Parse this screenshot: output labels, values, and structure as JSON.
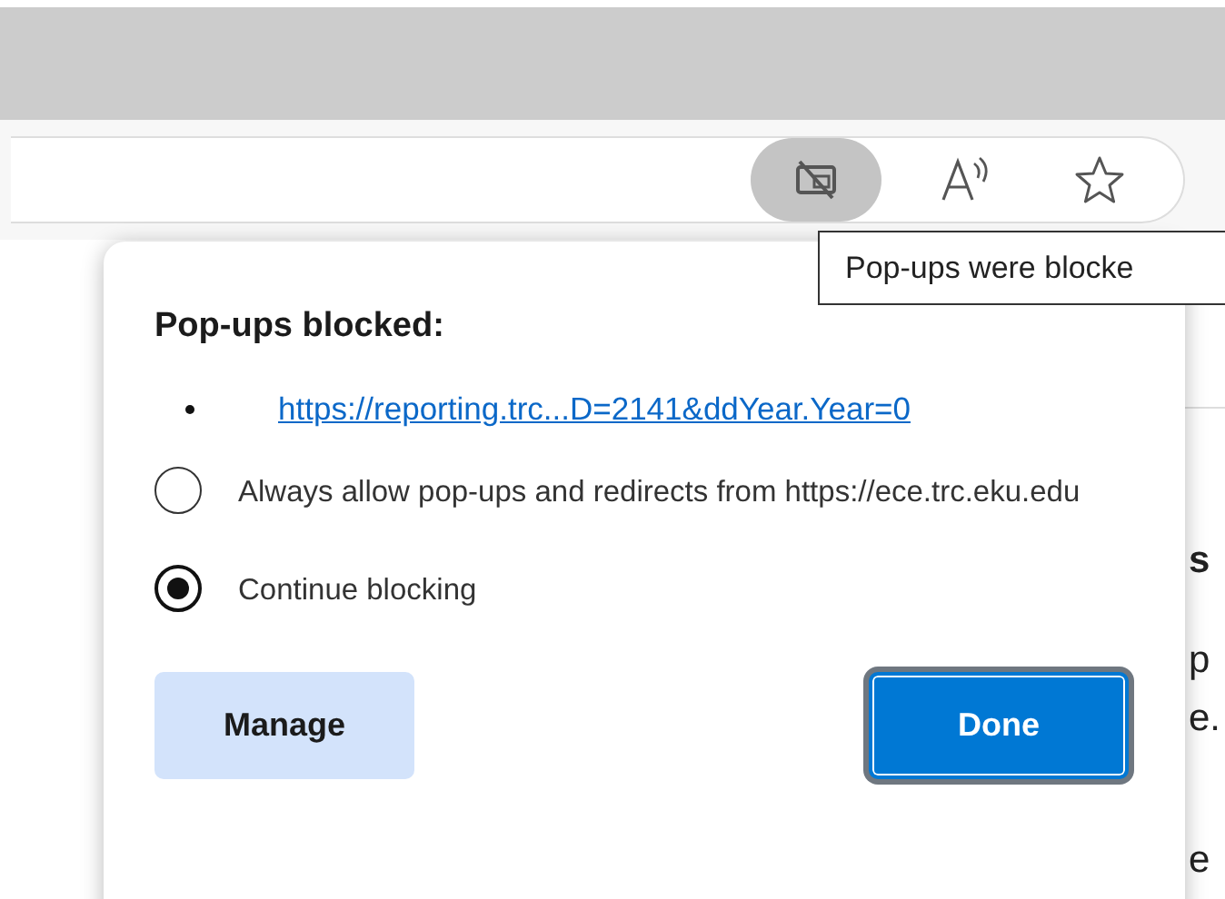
{
  "toolbar": {
    "icons": [
      {
        "kind": "popup-blocked",
        "active": true
      },
      {
        "kind": "read-aloud",
        "active": false
      },
      {
        "kind": "favorite",
        "active": false
      }
    ]
  },
  "tooltip": {
    "text": "Pop-ups were blocke"
  },
  "page_fragments": [
    "s",
    "p",
    "e.",
    "e"
  ],
  "popup": {
    "title": "Pop-ups blocked:",
    "blocked_links": [
      "https://reporting.trc...D=2141&ddYear.Year=0"
    ],
    "options": [
      {
        "label": "Always allow pop-ups and redirects from https://ece.trc.eku.edu",
        "selected": false
      },
      {
        "label": "Continue blocking",
        "selected": true
      }
    ],
    "buttons": [
      {
        "label": "Manage",
        "kind": "secondary"
      },
      {
        "label": "Done",
        "kind": "primary"
      }
    ]
  }
}
